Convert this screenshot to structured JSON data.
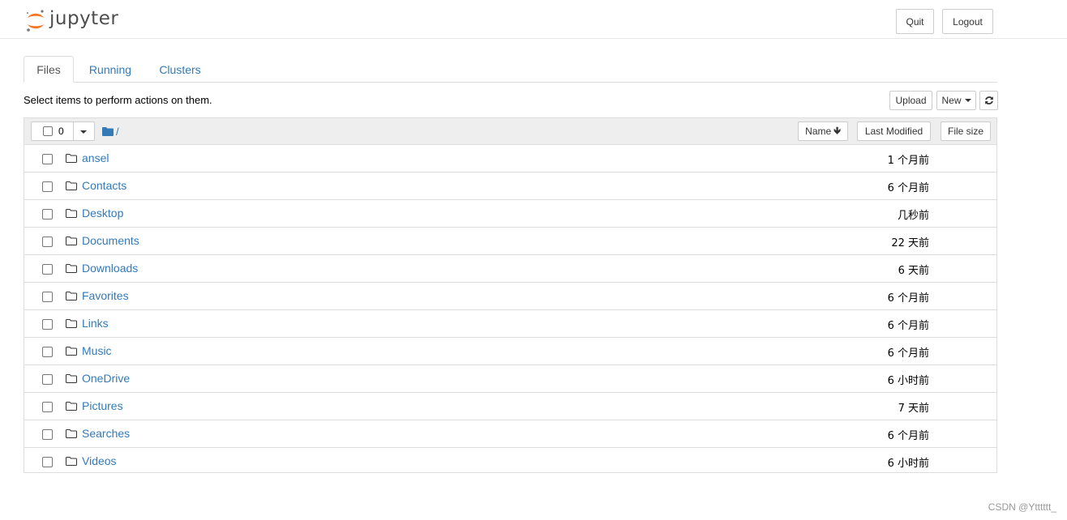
{
  "header": {
    "logo_text": "jupyter",
    "quit_label": "Quit",
    "logout_label": "Logout"
  },
  "tabs": [
    {
      "label": "Files",
      "active": true
    },
    {
      "label": "Running",
      "active": false
    },
    {
      "label": "Clusters",
      "active": false
    }
  ],
  "toolbar": {
    "info_text": "Select items to perform actions on them.",
    "upload_label": "Upload",
    "new_label": "New",
    "refresh_icon": "refresh-icon"
  },
  "list_header": {
    "selected_count": "0",
    "breadcrumb_sep": "/",
    "sort_name_label": "Name",
    "sort_name_arrow": "🡻",
    "sort_modified_label": "Last Modified",
    "sort_size_label": "File size"
  },
  "files": [
    {
      "name": "ansel",
      "modified": "1 个月前"
    },
    {
      "name": "Contacts",
      "modified": "6 个月前"
    },
    {
      "name": "Desktop",
      "modified": "几秒前"
    },
    {
      "name": "Documents",
      "modified": "22 天前"
    },
    {
      "name": "Downloads",
      "modified": "6 天前"
    },
    {
      "name": "Favorites",
      "modified": "6 个月前"
    },
    {
      "name": "Links",
      "modified": "6 个月前"
    },
    {
      "name": "Music",
      "modified": "6 个月前"
    },
    {
      "name": "OneDrive",
      "modified": "6 小时前"
    },
    {
      "name": "Pictures",
      "modified": "7 天前"
    },
    {
      "name": "Searches",
      "modified": "6 个月前"
    },
    {
      "name": "Videos",
      "modified": "6 小时前"
    }
  ],
  "watermark": "CSDN @Ytttttt_",
  "colors": {
    "link": "#337ab7",
    "logo_orange": "#f37726",
    "header_bg": "#eeeeee"
  }
}
